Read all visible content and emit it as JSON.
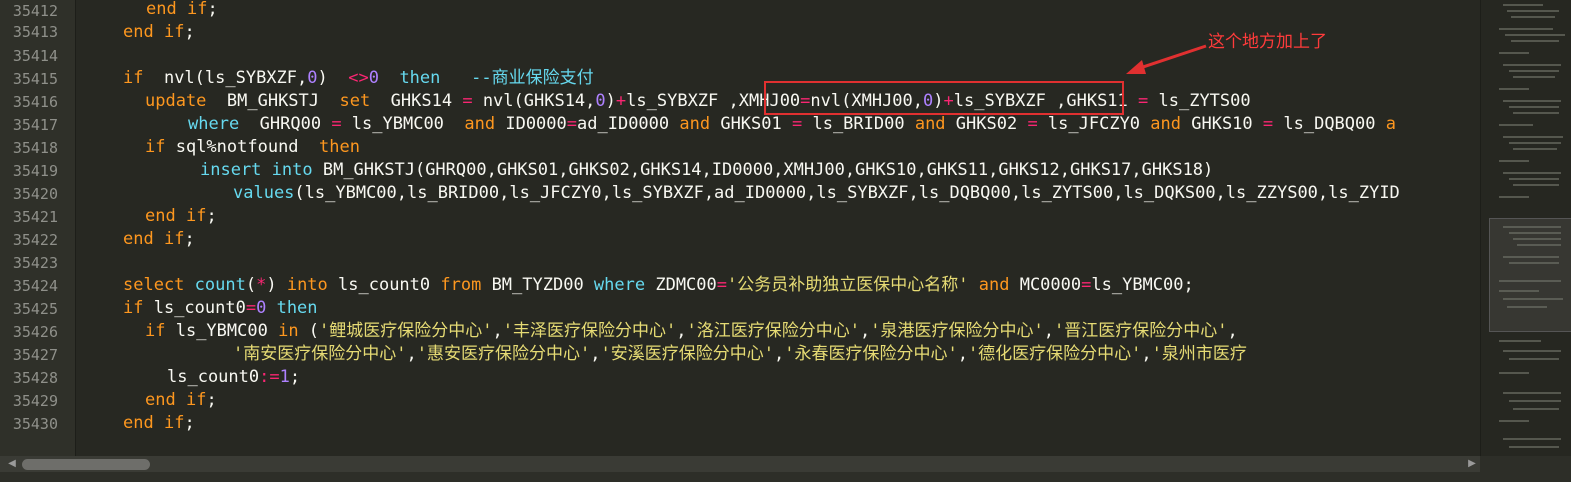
{
  "gutter": {
    "line_numbers": [
      "35412",
      "35413",
      "35414",
      "35415",
      "35416",
      "35417",
      "35418",
      "35419",
      "35420",
      "35421",
      "35422",
      "35423",
      "35424",
      "35425",
      "35426",
      "35427",
      "35428",
      "35429",
      "35430"
    ]
  },
  "code": {
    "l1": {
      "a": "end",
      "b": " if",
      "c": ";"
    },
    "l2": {
      "a": "end",
      "b": " if",
      "c": ";"
    },
    "l4": {
      "a": "if",
      "b": "  nvl(ls_SYBXZF,",
      "n0": "0",
      "c": ")  ",
      "op": "<>",
      "n1": "0",
      "d": "  ",
      "then": "then",
      "e": "   ",
      "comment": "--商业保险支付"
    },
    "l5": {
      "a": "update",
      "b": "  BM_GHKSTJ  ",
      "set": "set",
      "c": "  GHKS14 ",
      "eq": "=",
      "d": " nvl(GHKS14,",
      "n0": "0",
      "e": ")",
      "plus": "+",
      "f": "ls_SYBXZF ",
      "g": ",XMHJ00",
      "eq2": "=",
      "h": "nvl(XMHJ00,",
      "n1": "0",
      "i": ")",
      "plus2": "+",
      "j": "ls_SYBXZF ",
      "k": ",GHKS11 ",
      "eq3": "=",
      "l": " ls_ZYTS00"
    },
    "l6": {
      "where": "where",
      "a": "  GHRQ00 ",
      "eq": "=",
      "b": " ls_YBMC00  ",
      "and1": "and",
      "c": " ID0000",
      "eq2": "=",
      "d": "ad_ID0000 ",
      "and2": "and",
      "e": " GHKS01 ",
      "eq3": "=",
      "f": " ls_BRID00 ",
      "and3": "and",
      "g": " GHKS02 ",
      "eq4": "=",
      "h": " ls_JFCZY0 ",
      "and4": "and",
      "i": " GHKS10 ",
      "eq5": "=",
      "j": " ls_DQBQ00 ",
      "and5": "a"
    },
    "l7": {
      "if": "if",
      "a": " sql%notfound  ",
      "then": "then"
    },
    "l8": {
      "insert": "insert",
      "into": " into",
      "a": " BM_GHKSTJ(GHRQ00,GHKS01,GHKS02,GHKS14,ID0000,XMHJ00,GHKS10,GHKS11,GHKS12,GHKS17,GHKS18)"
    },
    "l9": {
      "values": "values",
      "a": "(ls_YBMC00,ls_BRID00,ls_JFCZY0,ls_SYBXZF,ad_ID0000,ls_SYBXZF,ls_DQBQ00,ls_ZYTS00,ls_DQKS00,ls_ZZYS00,ls_ZYID"
    },
    "l10": {
      "a": "end",
      "b": " if",
      "c": ";"
    },
    "l11": {
      "a": "end",
      "b": " if",
      "c": ";"
    },
    "l13": {
      "select": "select",
      "count": " count",
      "a": "(",
      "star": "*",
      "b": ")",
      "into": " into",
      "c": " ls_count0 ",
      "from": "from",
      "d": " BM_TYZD00 ",
      "where": "where",
      "e": " ZDMC00",
      "eq": "=",
      "s": "'公务员补助独立医保中心名称'",
      "f": " ",
      "and": "and",
      "g": " MC0000",
      "eq2": "=",
      "h": "ls_YBMC00;"
    },
    "l14": {
      "if": "if",
      "a": " ls_count0",
      "eq": "=",
      "n": "0",
      "then": " then"
    },
    "l15": {
      "if": "if",
      "a": " ls_YBMC00 ",
      "in": "in",
      "b": " (",
      "s1": "'鲤城医疗保险分中心'",
      "c1": ",",
      "s2": "'丰泽医疗保险分中心'",
      "c2": ",",
      "s3": "'洛江医疗保险分中心'",
      "c3": ",",
      "s4": "'泉港医疗保险分中心'",
      "c4": ",",
      "s5": "'晋江医疗保险分中心'",
      "c5": ","
    },
    "l16": {
      "s1": "'南安医疗保险分中心'",
      "c1": ",",
      "s2": "'惠安医疗保险分中心'",
      "c2": ",",
      "s3": "'安溪医疗保险分中心'",
      "c3": ",",
      "s4": "'永春医疗保险分中心'",
      "c4": ",",
      "s5": "'德化医疗保险分中心'",
      "c5": ",",
      "s6": "'泉州市医疗"
    },
    "l17": {
      "a": "ls_count0",
      "op": ":=",
      "n": "1",
      "b": ";"
    },
    "l18": {
      "a": "end",
      "b": " if",
      "c": ";"
    },
    "l19": {
      "a": "end",
      "b": " if",
      "c": ";"
    }
  },
  "annotation": {
    "text": "这个地方加上了"
  },
  "scrollbar": {
    "left_arrow": "◀",
    "right_arrow": "▶"
  },
  "colors": {
    "background": "#272822",
    "keyword": "#f92672",
    "comment": "#66d9ef",
    "string": "#e6db74",
    "number": "#ae81ff",
    "highlight_box": "#e03030",
    "annotation": "#ff3b3b"
  }
}
